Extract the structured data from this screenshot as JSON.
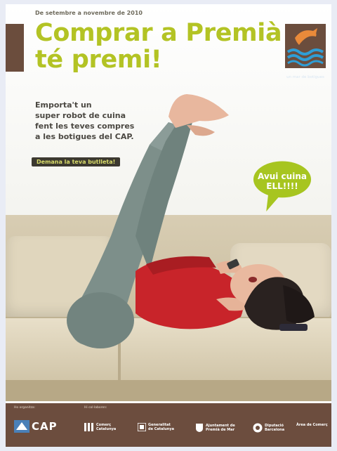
{
  "header": {
    "date_range": "De setembre a novembre de 2010",
    "title": "Comprar a Premià\nté premi!"
  },
  "logo": {
    "caption": "un mar de botigues",
    "icon": "dolphin-over-waves-icon"
  },
  "promo": {
    "text": "Emporta't un\nsuper robot de cuina\nfent les teves compres\na les botigues del CAP.",
    "cta": "Demana la teva butlleta!"
  },
  "speech_bubble": {
    "text": "Avui cuina\nELL!!!!"
  },
  "footer": {
    "organitza_label": "Ho organitza:",
    "support_label": "Hi col·laboren:",
    "organizer": "CAP",
    "sponsors": [
      {
        "name": "Comerç\nCatalunya",
        "icon": "bars-icon"
      },
      {
        "name": "Generalitat\nde Catalunya",
        "icon": "generalitat-icon"
      },
      {
        "name": "Ajuntament de\nPremià de Mar",
        "icon": "crest-icon"
      },
      {
        "name": "Diputació\nBarcelona",
        "icon": "diputacio-icon"
      },
      {
        "name": "Àrea de Comerç",
        "icon": ""
      }
    ]
  },
  "colors": {
    "title_green": "#b3c324",
    "brown": "#6b4d3d",
    "bubble_green": "#a7c520"
  }
}
